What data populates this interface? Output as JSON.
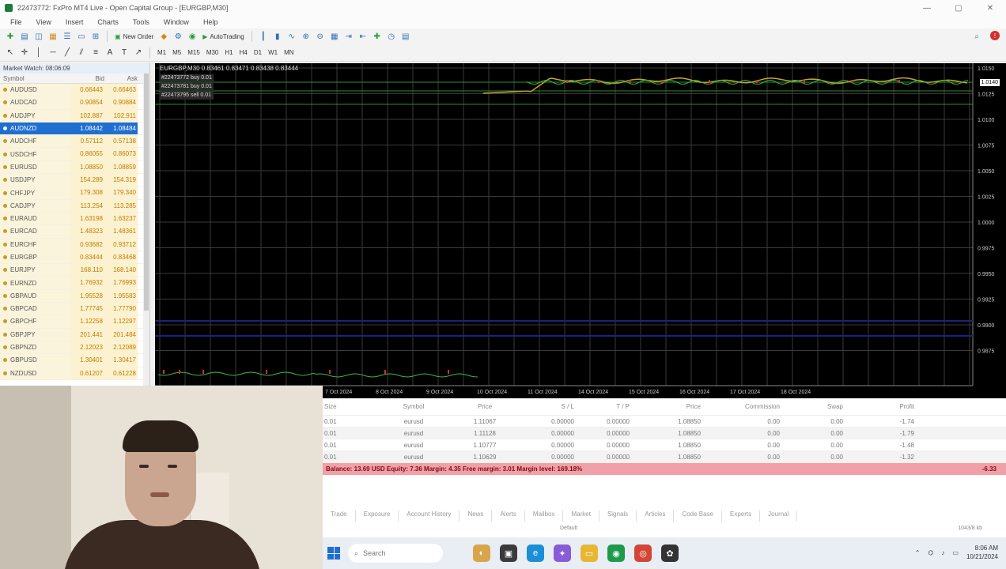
{
  "window": {
    "title": "22473772: FxPro MT4 Live - Open Capital Group - [EURGBP,M30]",
    "controls": [
      "—",
      "▢",
      "✕"
    ]
  },
  "menu": [
    "File",
    "View",
    "Insert",
    "Charts",
    "Tools",
    "Window",
    "Help"
  ],
  "toolbar": {
    "new_order": "New Order",
    "auto_trading": "AutoTrading",
    "timeframes": [
      "M1",
      "M5",
      "M15",
      "M30",
      "H1",
      "H4",
      "D1",
      "W1",
      "MN"
    ]
  },
  "market_watch": {
    "title": "Market Watch: 08:06:09",
    "columns": [
      "Symbol",
      "Bid",
      "Ask"
    ],
    "rows": [
      {
        "symbol": "AUDUSD",
        "bid": "0.66443",
        "ask": "0.66463"
      },
      {
        "symbol": "AUDCAD",
        "bid": "0.90854",
        "ask": "0.90884"
      },
      {
        "symbol": "AUDJPY",
        "bid": "102.887",
        "ask": "102.911"
      },
      {
        "symbol": "AUDNZD",
        "bid": "1.08442",
        "ask": "1.08484"
      },
      {
        "symbol": "AUDCHF",
        "bid": "0.57112",
        "ask": "0.57138"
      },
      {
        "symbol": "USDCHF",
        "bid": "0.86055",
        "ask": "0.86073"
      },
      {
        "symbol": "EURUSD",
        "bid": "1.08850",
        "ask": "1.08859"
      },
      {
        "symbol": "USDJPY",
        "bid": "154.289",
        "ask": "154.319"
      },
      {
        "symbol": "CHFJPY",
        "bid": "179.308",
        "ask": "179.340"
      },
      {
        "symbol": "CADJPY",
        "bid": "113.254",
        "ask": "113.285"
      },
      {
        "symbol": "EURAUD",
        "bid": "1.63198",
        "ask": "1.63237"
      },
      {
        "symbol": "EURCAD",
        "bid": "1.48323",
        "ask": "1.48361"
      },
      {
        "symbol": "EURCHF",
        "bid": "0.93682",
        "ask": "0.93712"
      },
      {
        "symbol": "EURGBP",
        "bid": "0.83444",
        "ask": "0.83468"
      },
      {
        "symbol": "EURJPY",
        "bid": "168.110",
        "ask": "168.140"
      },
      {
        "symbol": "EURNZD",
        "bid": "1.76932",
        "ask": "1.76993"
      },
      {
        "symbol": "GBPAUD",
        "bid": "1.95528",
        "ask": "1.95583"
      },
      {
        "symbol": "GBPCAD",
        "bid": "1.77745",
        "ask": "1.77790"
      },
      {
        "symbol": "GBPCHF",
        "bid": "1.12258",
        "ask": "1.12297"
      },
      {
        "symbol": "GBPJPY",
        "bid": "201.441",
        "ask": "201.484"
      },
      {
        "symbol": "GBPNZD",
        "bid": "2.12023",
        "ask": "2.12089"
      },
      {
        "symbol": "GBPUSD",
        "bid": "1.30401",
        "ask": "1.30417"
      },
      {
        "symbol": "NZDUSD",
        "bid": "0.61207",
        "ask": "0.61228"
      }
    ],
    "selected_index": 3
  },
  "chart": {
    "header": "EURGBP,M30 0.83461 0.83471 0.83438 0.83444",
    "legend": [
      "#22473772 buy 0.01",
      "#22473781 buy 0.01",
      "#22473795 sell 0.01"
    ],
    "price_axis": [
      "1.0150",
      "1.0125",
      "1.0100",
      "1.0075",
      "1.0050",
      "1.0025",
      "1.0000",
      "0.9975",
      "0.9950",
      "0.9925",
      "0.9900",
      "0.9875"
    ],
    "current_price": "1.0140",
    "time_axis": [
      "7 Oct 2024",
      "8 Oct 2024",
      "9 Oct 2024",
      "10 Oct 2024",
      "11 Oct 2024",
      "14 Oct 2024",
      "15 Oct 2024",
      "16 Oct 2024",
      "17 Oct 2024",
      "18 Oct 2024"
    ]
  },
  "terminal": {
    "columns": [
      "Size",
      "Symbol",
      "Price",
      "S / L",
      "T / P",
      "Price",
      "Commission",
      "Swap",
      "Profit"
    ],
    "rows": [
      [
        "0.01",
        "eurusd",
        "1.11067",
        "0.00000",
        "0.00000",
        "1.08850",
        "0.00",
        "0.00",
        "-1.74"
      ],
      [
        "0.01",
        "eurusd",
        "1.11128",
        "0.00000",
        "0.00000",
        "1.08850",
        "0.00",
        "0.00",
        "-1.79"
      ],
      [
        "0.01",
        "eurusd",
        "1.10777",
        "0.00000",
        "0.00000",
        "1.08850",
        "0.00",
        "0.00",
        "-1.48"
      ],
      [
        "0.01",
        "eurusd",
        "1.10629",
        "0.00000",
        "0.00000",
        "1.08850",
        "0.00",
        "0.00",
        "-1.32"
      ]
    ],
    "balance_text": "Balance: 13.69 USD  Equity: 7.36  Margin: 4.35  Free margin: 3.01  Margin level: 169.18%",
    "total_profit": "-6.33",
    "tabs": [
      "Trade",
      "Exposure",
      "Account History",
      "News",
      "Alerts",
      "Mailbox",
      "Market",
      "Signals",
      "Articles",
      "Code Base",
      "Experts",
      "Journal"
    ],
    "status_default": "Default",
    "status_right": "1043/8 kb"
  },
  "taskbar": {
    "search_placeholder": "Search",
    "time": "8:06 AM",
    "date": "10/21/2024"
  }
}
